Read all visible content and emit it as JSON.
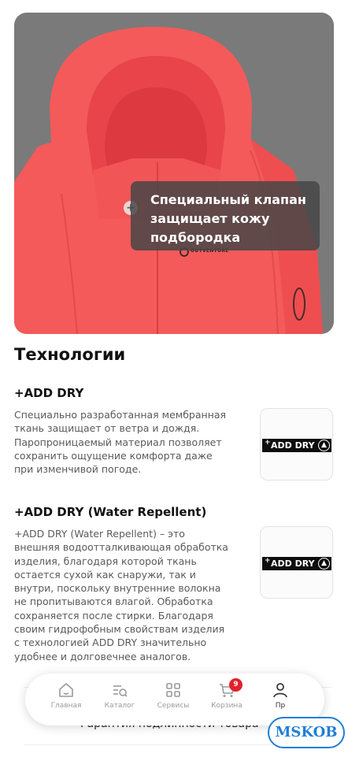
{
  "hero": {
    "image": "coral-hooded-jacket",
    "logo_text": "OUTVENTURE",
    "tooltip_lines": [
      "Специальный клапан",
      "защищает кожу",
      "подбородка"
    ]
  },
  "technologies": {
    "title": "Технологии",
    "items": [
      {
        "name": "+ADD DRY",
        "badge_text": "ADD DRY",
        "lines": [
          "Специально разработанная мембранная",
          "ткань защищает от ветра и дождя.",
          "Паропроницаемый материал позволяет",
          "сохранить ощущение комфорта даже",
          "при изменчивой погоде."
        ]
      },
      {
        "name": "+ADD DRY (Water Repellent)",
        "badge_text": "ADD DRY",
        "lines": [
          "+ADD DRY (Water Repellent) – это",
          "внешняя водоотталкивающая обработка",
          "изделия, благодаря которой ткань",
          "остается сухой как снаружи, так и",
          "внутри, поскольку внутренние волокна",
          "не пропитываются влагой. Обработка",
          "сохраняется после стирки. Благодаря",
          "своим гидрофобным свойствам изделия",
          "с технологией ADD DRY значительно",
          "удобнее и долговечнее аналогов."
        ]
      }
    ]
  },
  "behind_nav_text": "Гарантия подлинности товара",
  "nav": {
    "items": [
      {
        "label": "Главная",
        "icon": "home-icon"
      },
      {
        "label": "Каталог",
        "icon": "catalog-icon"
      },
      {
        "label": "Сервисы",
        "icon": "services-icon"
      },
      {
        "label": "Корзина",
        "icon": "cart-icon"
      },
      {
        "label": "Пр",
        "icon": "profile-icon"
      }
    ],
    "cart_count": "9"
  },
  "watermark": "MSKOB",
  "colors": {
    "jacket": "#f45a5a",
    "background": "#7a7a7a",
    "badge_red": "#e3212c",
    "watermark_blue": "#1f7fd4"
  }
}
